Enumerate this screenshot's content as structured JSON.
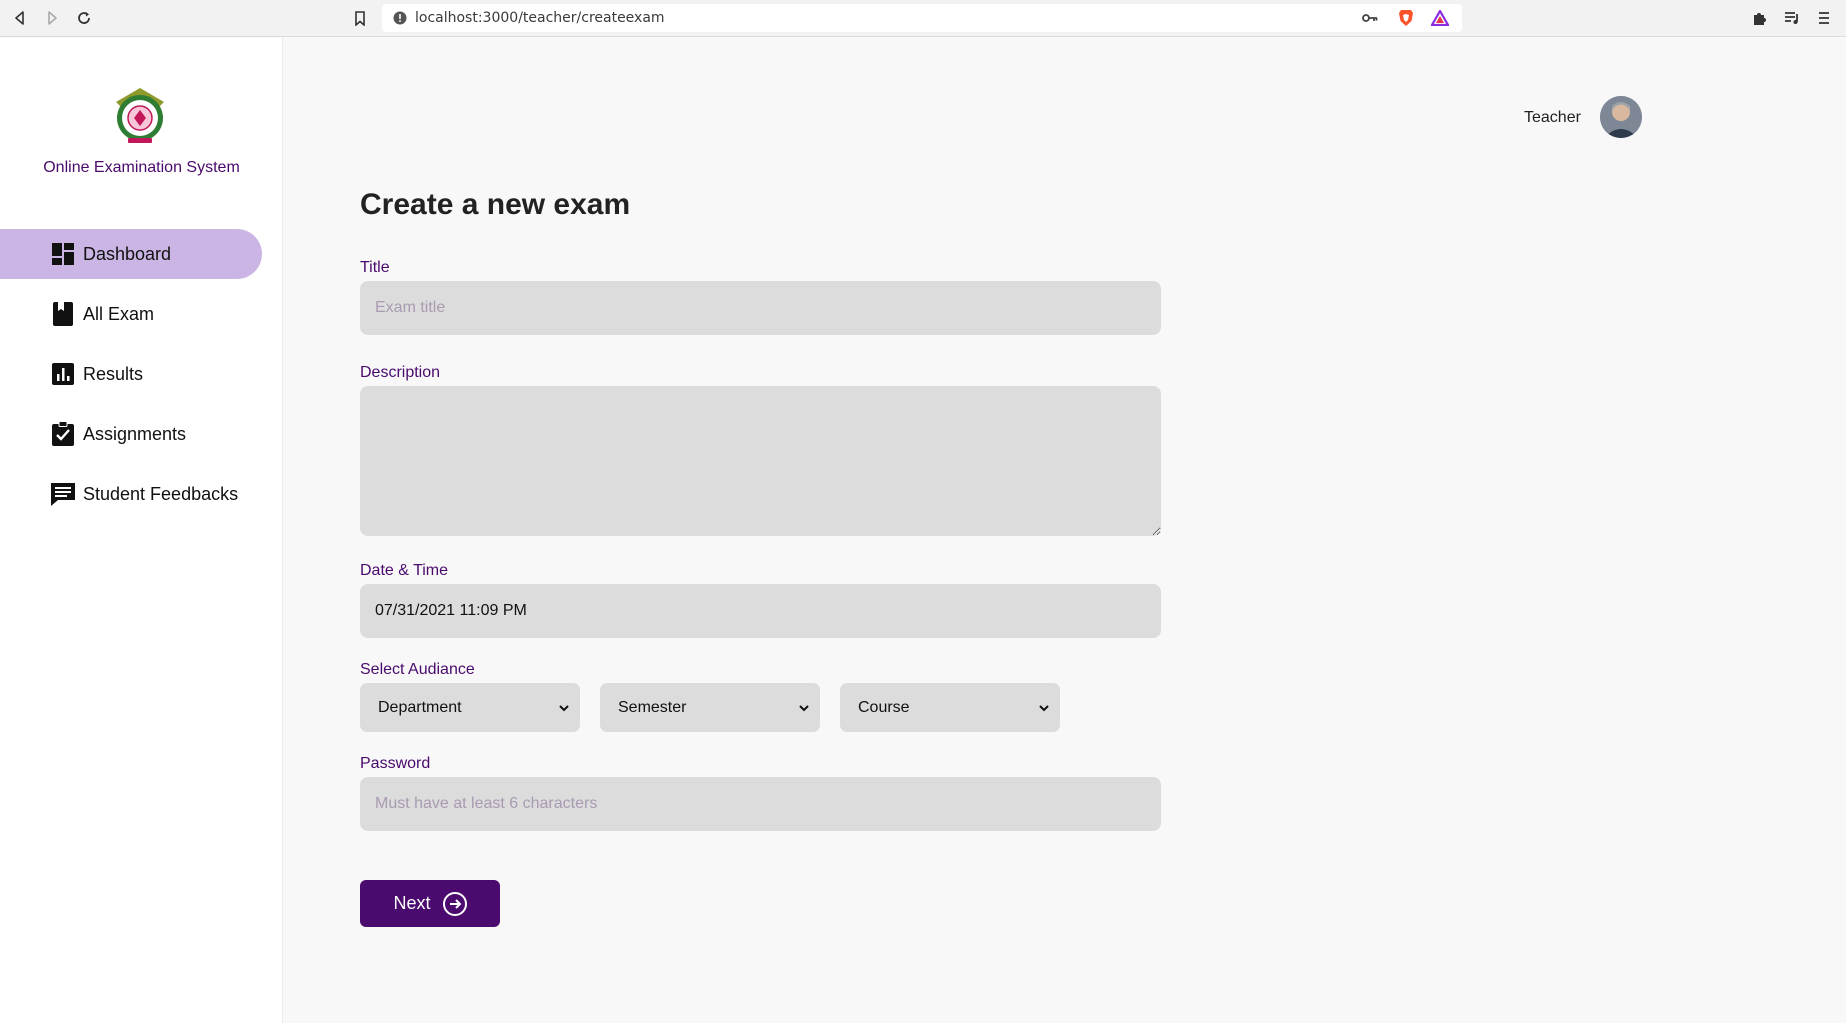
{
  "browser": {
    "url": "localhost:3000/teacher/createexam"
  },
  "sidebar": {
    "app_title": "Online Examination System",
    "items": [
      {
        "label": "Dashboard",
        "icon": "dashboard-icon",
        "active": true
      },
      {
        "label": "All Exam",
        "icon": "book-icon",
        "active": false
      },
      {
        "label": "Results",
        "icon": "bar-chart-icon",
        "active": false
      },
      {
        "label": "Assignments",
        "icon": "clipboard-check-icon",
        "active": false
      },
      {
        "label": "Student Feedbacks",
        "icon": "chat-icon",
        "active": false
      }
    ]
  },
  "header": {
    "user_role": "Teacher"
  },
  "form": {
    "heading": "Create a new exam",
    "title_label": "Title",
    "title_placeholder": "Exam title",
    "description_label": "Description",
    "datetime_label": "Date & Time",
    "datetime_value": "07/31/2021 11:09 PM",
    "audience_label": "Select Audiance",
    "department": "Department",
    "semester": "Semester",
    "course": "Course",
    "password_label": "Password",
    "password_placeholder": "Must have at least 6 characters",
    "next_label": "Next"
  },
  "colors": {
    "accent": "#4b0a6e",
    "active_nav": "#cbb5e4",
    "input_bg": "#dcdcdc"
  }
}
